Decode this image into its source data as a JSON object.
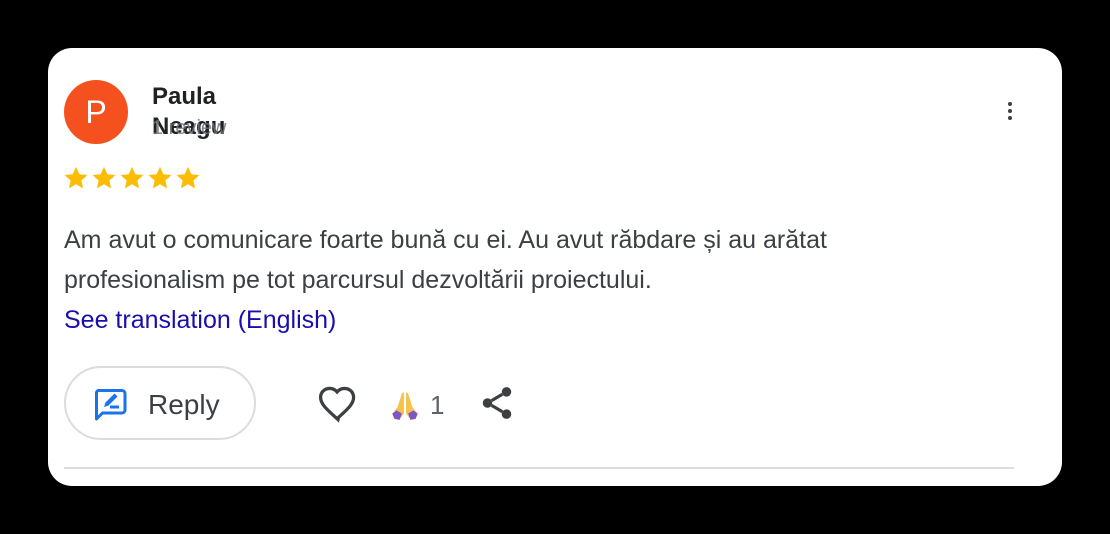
{
  "review": {
    "avatar_letter": "P",
    "avatar_color": "#f4511e",
    "reviewer_name": "Paula Neagu",
    "reviewer_subtitle": "1 review",
    "rating": 5,
    "rating_max": 5,
    "star_color": "#fbbc04",
    "text": "Am avut o comunicare foarte bună cu ei. Au avut răbdare și au arătat profesionalism pe tot parcursul dezvoltării proiectului.",
    "translation_link": "See translation (English)"
  },
  "actions": {
    "reply_label": "Reply",
    "reaction_count": "1",
    "icons": [
      "more-vert-icon",
      "reply-icon",
      "heart-icon",
      "pray-emoji-icon",
      "share-icon"
    ]
  },
  "colors": {
    "link": "#1a0dab",
    "reply_icon": "#1a73e8",
    "text": "#3c4043"
  }
}
